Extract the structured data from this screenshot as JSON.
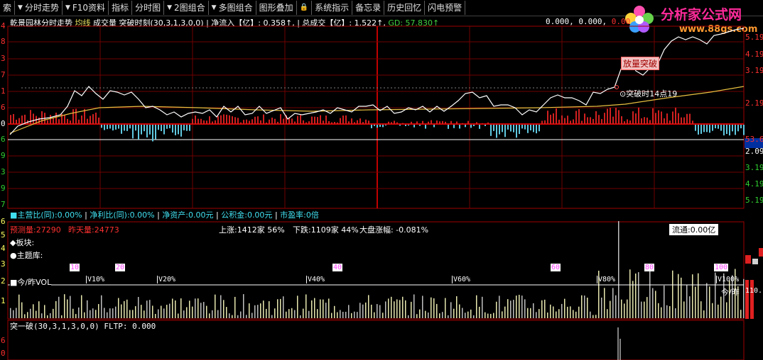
{
  "toolbar": {
    "items": [
      {
        "label": "索",
        "arrow": false
      },
      {
        "label": "分时走势",
        "arrow": true
      },
      {
        "label": "F10资料",
        "arrow": true
      },
      {
        "label": "指标",
        "arrow": false
      },
      {
        "label": "分时图",
        "arrow": false
      },
      {
        "label": "2图组合",
        "arrow": true
      },
      {
        "label": "多图组合",
        "arrow": true
      },
      {
        "label": "图形叠加",
        "arrow": false
      },
      {
        "label": "系统指示",
        "arrow": false
      },
      {
        "label": "备忘录",
        "arrow": false
      },
      {
        "label": "历史回忆",
        "arrow": false
      },
      {
        "label": "闪电预警",
        "arrow": false
      }
    ]
  },
  "logo": {
    "title": "分析家公式网",
    "url": "www.88gs.com"
  },
  "header": {
    "stock": "乾景园林分时走势",
    "avg": "均线",
    "vol": "成交量",
    "indicator": "突破时刻(30,3,1,3,0,0)",
    "net_in": "净流入【亿】: 0.358↑,",
    "total": "总成交【亿】: 1.522↑,",
    "gd": "GD: 57.830↑",
    "right_vals": "0.000, 0.000,",
    "right_red": "0.00"
  },
  "left_axis_main": [
    "4",
    "8",
    "3",
    "7",
    "1",
    "6",
    "0",
    "6",
    "9",
    "3",
    "9",
    "7"
  ],
  "left_axis_sub": [
    "6",
    "5",
    "4",
    "3",
    "2",
    "1"
  ],
  "left_axis_bottom": [
    "6",
    "0"
  ],
  "right_axis": [
    "5.19",
    "4.19",
    "3.19",
    "2.19",
    "1.09",
    "53.6",
    "2.09",
    "3.19",
    "4.19",
    "5.19"
  ],
  "chart_labels": {
    "breakout_tag": "放量突破",
    "breakout_time": "⊙突破时14点19"
  },
  "finance_line": {
    "zyb": "■主营比(同):0.00%",
    "jlb": "净利比(同):0.00%",
    "jzc": "净资产:0.00元",
    "gjj": "公积金:0.00元",
    "syl": "市盈率:0倍"
  },
  "vol_panel": {
    "forecast": "预测量:27290",
    "yesterday": "昨天量:24773",
    "up": "上涨:1412家 56%",
    "down": "下跌:1109家 44%",
    "market": "大盘涨幅: -0.081%",
    "flow": "流通:0.00亿",
    "sector": "◆板块:",
    "theme": "●主题库:",
    "legend": "■今/昨VOL",
    "ratio_right": "今/昨",
    "pct_right": "110.",
    "pct_ticks": [
      "10",
      "20",
      "40",
      "60",
      "80",
      "100"
    ],
    "v_ticks": [
      "V10%",
      "V20%",
      "V40%",
      "V60%",
      "V80%",
      "V100%"
    ]
  },
  "bottom_panel": {
    "title": "突一破(30,3,1,3,0,0)",
    "fltp": "FLTP: 0.000"
  }
}
